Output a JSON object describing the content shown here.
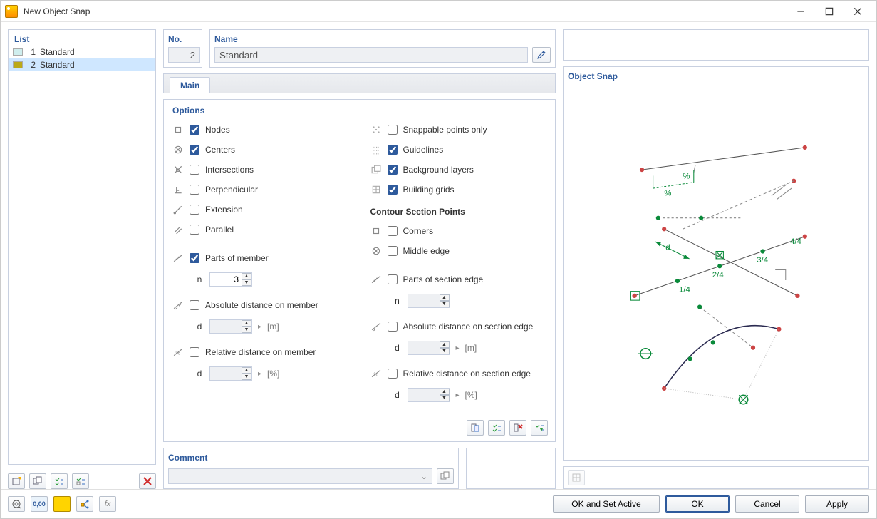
{
  "window": {
    "title": "New Object Snap"
  },
  "list": {
    "title": "List",
    "items": [
      {
        "idx": "1",
        "name": "Standard",
        "color": "#cfeeee",
        "selected": false
      },
      {
        "idx": "2",
        "name": "Standard",
        "color": "#bca918",
        "selected": true
      }
    ]
  },
  "header": {
    "no_label": "No.",
    "no_value": "2",
    "name_label": "Name",
    "name_value": "Standard"
  },
  "tab": {
    "main_label": "Main"
  },
  "options": {
    "title": "Options",
    "left": {
      "nodes": {
        "label": "Nodes",
        "checked": true
      },
      "centers": {
        "label": "Centers",
        "checked": true
      },
      "intersections": {
        "label": "Intersections",
        "checked": false
      },
      "perpendicular": {
        "label": "Perpendicular",
        "checked": false
      },
      "extension": {
        "label": "Extension",
        "checked": false
      },
      "parallel": {
        "label": "Parallel",
        "checked": false
      },
      "parts_member": {
        "label": "Parts of member",
        "checked": true,
        "n_label": "n",
        "n_value": "3"
      },
      "abs_member": {
        "label": "Absolute distance on member",
        "checked": false,
        "d_label": "d",
        "d_value": "",
        "unit": "[m]"
      },
      "rel_member": {
        "label": "Relative distance on member",
        "checked": false,
        "d_label": "d",
        "d_value": "",
        "unit": "[%]"
      }
    },
    "right": {
      "snappable": {
        "label": "Snappable points only",
        "checked": false
      },
      "guidelines": {
        "label": "Guidelines",
        "checked": true
      },
      "background": {
        "label": "Background layers",
        "checked": true
      },
      "grids": {
        "label": "Building grids",
        "checked": true
      },
      "contour_title": "Contour Section Points",
      "corners": {
        "label": "Corners",
        "checked": false
      },
      "middle": {
        "label": "Middle edge",
        "checked": false
      },
      "parts_section": {
        "label": "Parts of section edge",
        "checked": false,
        "n_label": "n",
        "n_value": ""
      },
      "abs_section": {
        "label": "Absolute distance on section edge",
        "checked": false,
        "d_label": "d",
        "d_value": "",
        "unit": "[m]"
      },
      "rel_section": {
        "label": "Relative distance on section edge",
        "checked": false,
        "d_label": "d",
        "d_value": "",
        "unit": "[%]"
      }
    }
  },
  "comment": {
    "title": "Comment",
    "value": ""
  },
  "preview": {
    "title": "Object Snap",
    "frac1": "1/4",
    "frac2": "2/4",
    "frac3": "3/4",
    "frac4": "4/4",
    "d_label": "d",
    "pct": "%",
    "pctx": "%"
  },
  "footer": {
    "ok_active": "OK and Set Active",
    "ok": "OK",
    "cancel": "Cancel",
    "apply": "Apply"
  }
}
